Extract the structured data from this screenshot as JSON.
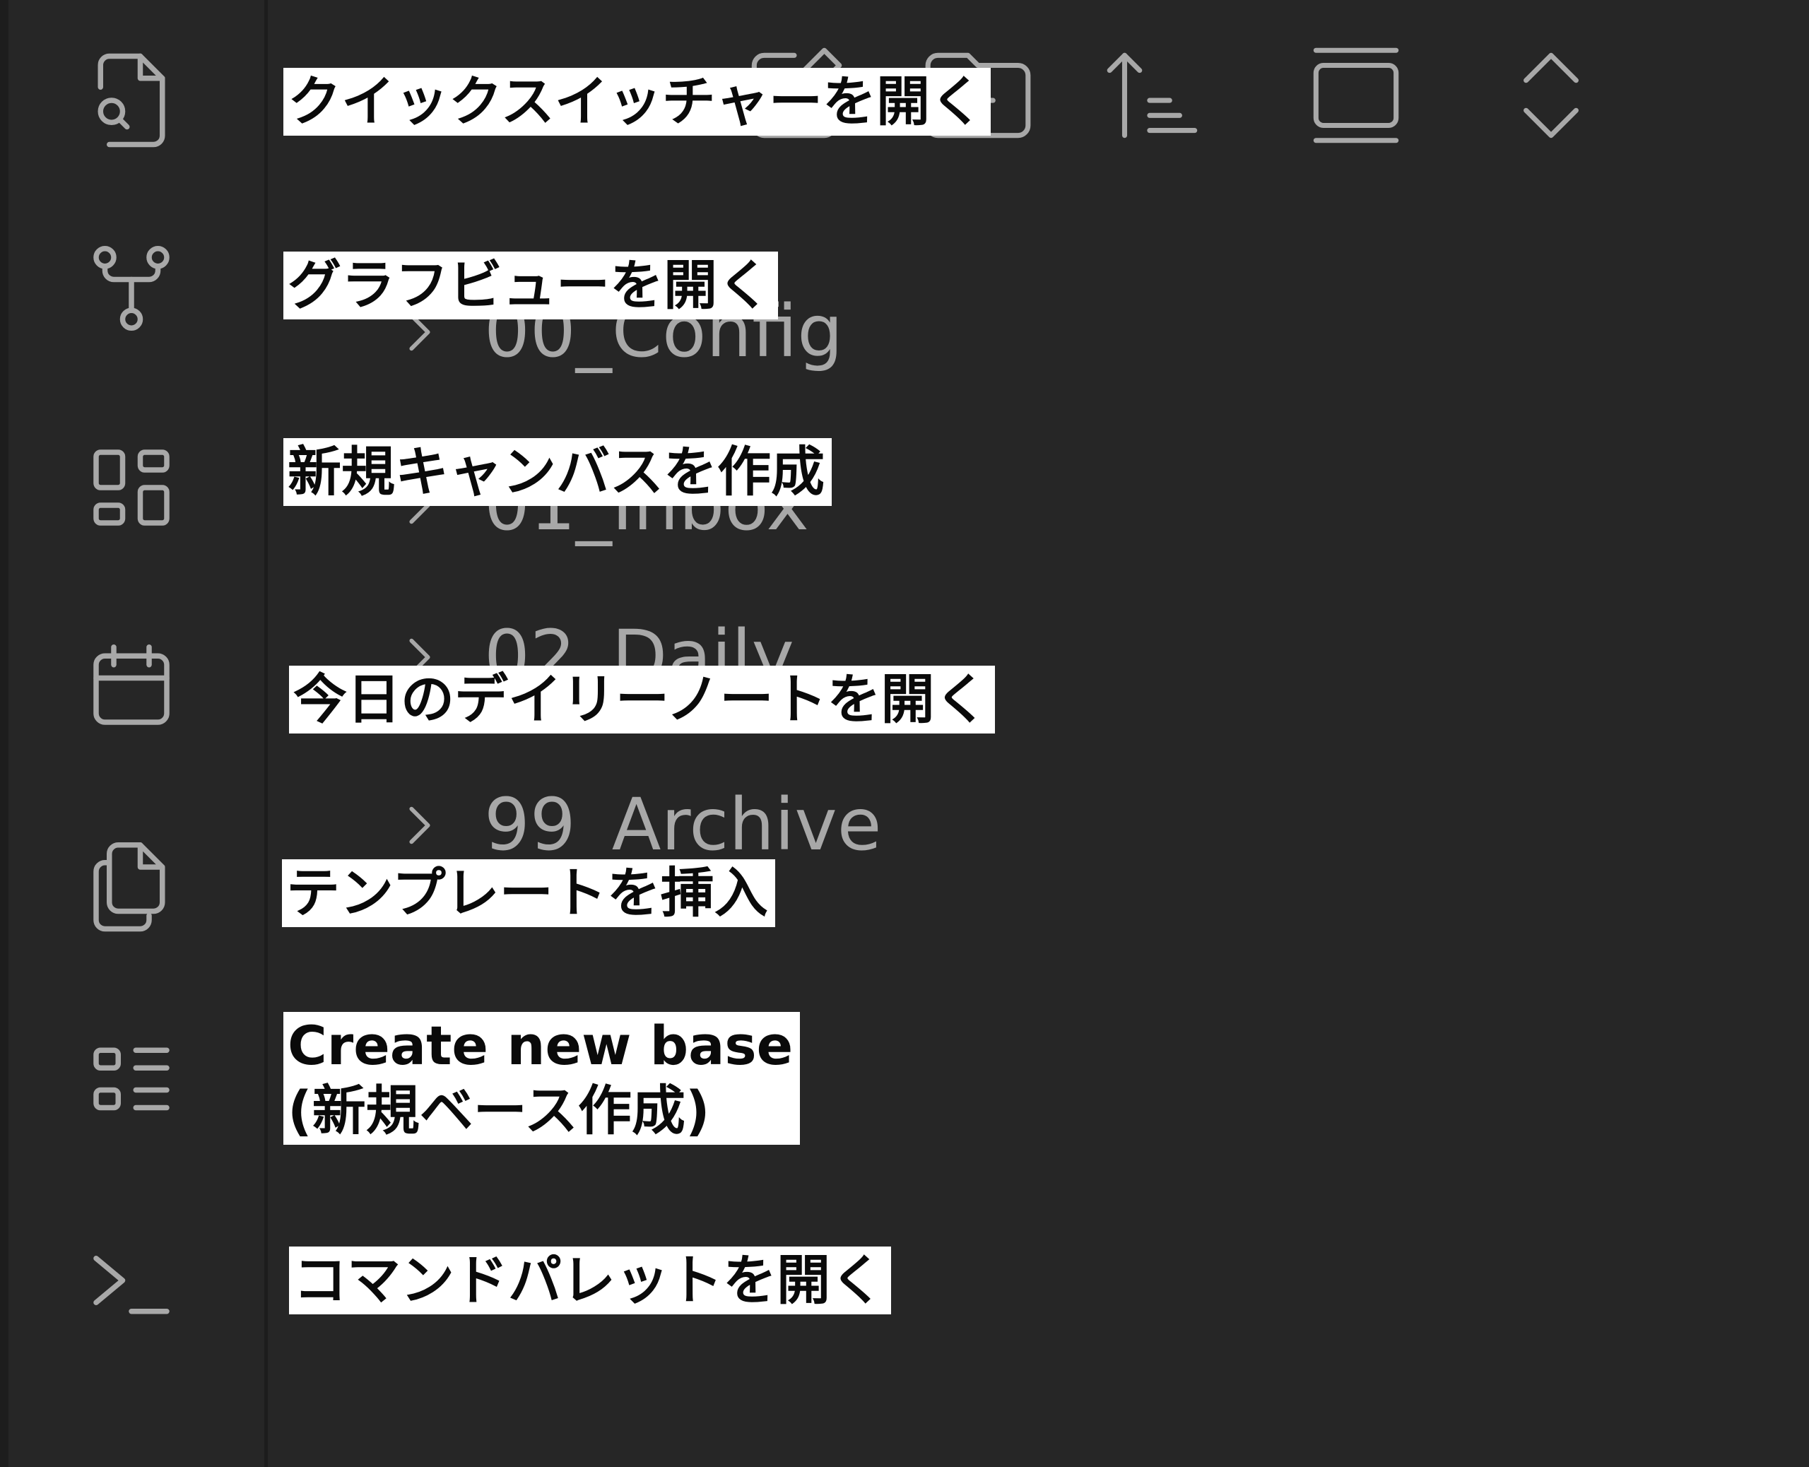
{
  "ribbon": {
    "items": [
      {
        "icon": "file-search-icon",
        "tooltip": "クイックスイッチャーを開く"
      },
      {
        "icon": "git-fork-icon",
        "tooltip": "グラフビューを開く"
      },
      {
        "icon": "layout-dashboard-icon",
        "tooltip": "新規キャンバスを作成"
      },
      {
        "icon": "calendar-icon",
        "tooltip": "今日のデイリーノートを開く"
      },
      {
        "icon": "copy-icon",
        "tooltip": "テンプレートを挿入"
      },
      {
        "icon": "list-icon",
        "tooltip_line1": "Create new base",
        "tooltip_line2": "(新規ベース作成)"
      },
      {
        "icon": "terminal-icon",
        "tooltip": "コマンドパレットを開く"
      }
    ]
  },
  "toolbar": {
    "icons": [
      "edit-icon",
      "folder-plus-icon",
      "sort-ascending-icon",
      "collapse-panel-icon",
      "expand-collapse-icon"
    ]
  },
  "file_tree": {
    "folders": [
      {
        "label": "00_Config"
      },
      {
        "label": "01_Inbox"
      },
      {
        "label": "02_Daily"
      },
      {
        "label": "99_Archive"
      }
    ]
  },
  "colors": {
    "background": "#262626",
    "icon": "#a8a8a8",
    "tooltip_background": "#ffffff",
    "tooltip_text": "#0a0a0a"
  }
}
